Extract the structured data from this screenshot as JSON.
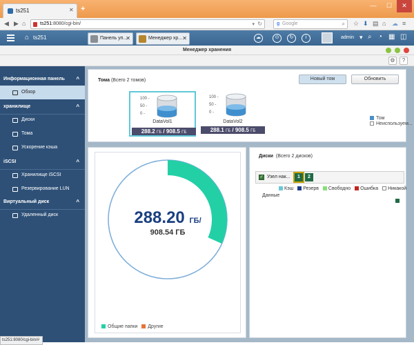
{
  "browser": {
    "tab_title": "ts251",
    "url_host": "ts251",
    "url_rest": ":8080/cgi-bin/",
    "search_placeholder": "Google",
    "status_url": "ts251:8080/cgi-bin/#"
  },
  "qnap": {
    "hostname": "ts251",
    "tabs": [
      {
        "label": "Панель уп...",
        "icon": "control-panel-icon"
      },
      {
        "label": "Менеджер хр...",
        "icon": "storage-manager-icon"
      }
    ],
    "username": "admin"
  },
  "window": {
    "title": "Менеджер хранения"
  },
  "sidebar": {
    "sections": [
      {
        "label": "Информационная панель",
        "items": [
          "Обзор"
        ]
      },
      {
        "label": "хранилище",
        "items": [
          "Диски",
          "Тома",
          "Ускорение кэша"
        ]
      },
      {
        "label": "iSCSI",
        "items": [
          "Хранилище iSCSI",
          "Резервирование LUN"
        ]
      },
      {
        "label": "Виртуальный диск",
        "items": [
          "Удаленный диск"
        ]
      }
    ],
    "active_item": "Обзор"
  },
  "volumes": {
    "title": "Тома",
    "count_text": "(Всего 2 томов)",
    "new_button": "Новый том",
    "refresh_button": "Обновить",
    "axis_ticks": [
      "100 -",
      "50 -",
      "0 -"
    ],
    "items": [
      {
        "name": "DataVol1",
        "used": "288.2",
        "total": "908.5",
        "unit": "ГБ",
        "fill_percent": 32
      },
      {
        "name": "DataVol2",
        "used": "288.1",
        "total": "908.5",
        "unit": "ГБ",
        "fill_percent": 32
      }
    ],
    "legend": [
      {
        "label": "Том",
        "color": "#4a90c8"
      },
      {
        "label": "Неиспользуем...",
        "color": "#ffffff"
      }
    ]
  },
  "donut": {
    "used": "288.20",
    "used_unit": "ГБ/",
    "total": "908.54 ГБ",
    "used_fraction": 0.317,
    "legend": [
      {
        "label": "Общие папки",
        "color": "#23d0a6"
      },
      {
        "label": "Другие",
        "color": "#e8733a"
      }
    ]
  },
  "disks": {
    "title": "Диски",
    "count_text": "(Всего 2 дисков)",
    "node_label": "Узел нак...",
    "disk_numbers": [
      "1",
      "2"
    ],
    "legend": [
      {
        "label": "Кэш",
        "color": "#6cc7d6"
      },
      {
        "label": "Резерв",
        "color": "#1d3a8a"
      },
      {
        "label": "Свободно",
        "color": "#86e07a"
      },
      {
        "label": "Ошибка",
        "color": "#c0261f"
      },
      {
        "label": "Никакой",
        "color": "#ffffff"
      }
    ],
    "data_label": "Данные"
  }
}
